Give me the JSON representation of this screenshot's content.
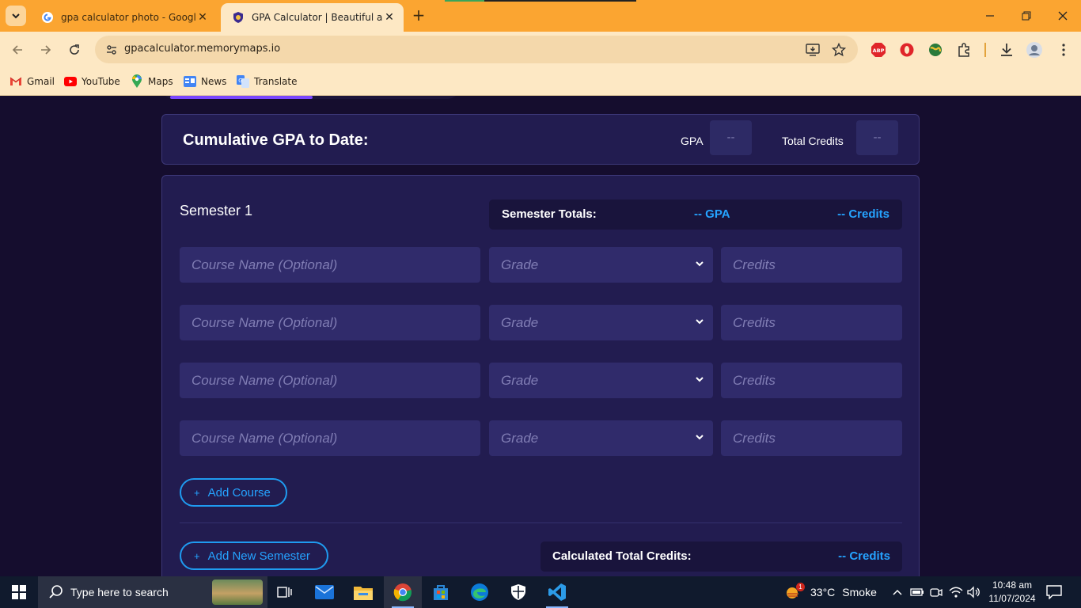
{
  "browser": {
    "tabs": [
      {
        "title": "gpa calculator photo - Google S",
        "active": false,
        "favicon": "google-icon"
      },
      {
        "title": "GPA Calculator | Beautiful and E",
        "active": true,
        "favicon": "gpa-calculator-icon"
      }
    ],
    "url": "gpacalculator.memorymaps.io",
    "bookmarks": [
      {
        "label": "Gmail",
        "icon": "gmail-icon"
      },
      {
        "label": "YouTube",
        "icon": "youtube-icon"
      },
      {
        "label": "Maps",
        "icon": "maps-icon"
      },
      {
        "label": "News",
        "icon": "news-icon"
      },
      {
        "label": "Translate",
        "icon": "translate-icon"
      }
    ],
    "extensions": [
      "abp-icon",
      "opera-icon",
      "globe-icon",
      "puzzle-icon"
    ]
  },
  "cumulative": {
    "title": "Cumulative GPA to Date:",
    "gpa_label": "GPA",
    "gpa_value": "--",
    "credits_label": "Total Credits",
    "credits_value": "--"
  },
  "semester": {
    "title": "Semester 1",
    "totals_label": "Semester Totals:",
    "totals_gpa": "-- GPA",
    "totals_credits": "-- Credits",
    "courses": [
      {
        "name_placeholder": "Course Name (Optional)",
        "grade_placeholder": "Grade",
        "credits_placeholder": "Credits"
      },
      {
        "name_placeholder": "Course Name (Optional)",
        "grade_placeholder": "Grade",
        "credits_placeholder": "Credits"
      },
      {
        "name_placeholder": "Course Name (Optional)",
        "grade_placeholder": "Grade",
        "credits_placeholder": "Credits"
      },
      {
        "name_placeholder": "Course Name (Optional)",
        "grade_placeholder": "Grade",
        "credits_placeholder": "Credits"
      }
    ],
    "add_course_label": "Add Course",
    "add_semester_label": "Add New Semester",
    "calc_label": "Calculated Total Credits:",
    "calc_value": "-- Credits"
  },
  "taskbar": {
    "search_placeholder": "Type here to search",
    "weather_temp": "33°C",
    "weather_desc": "Smoke",
    "weather_badge": "1",
    "time": "10:48 am",
    "date": "11/07/2024"
  },
  "colors": {
    "accent": "#25a3ff",
    "card_bg": "#221c50",
    "page_bg": "#150d2e",
    "browser_frame": "#fba531"
  }
}
